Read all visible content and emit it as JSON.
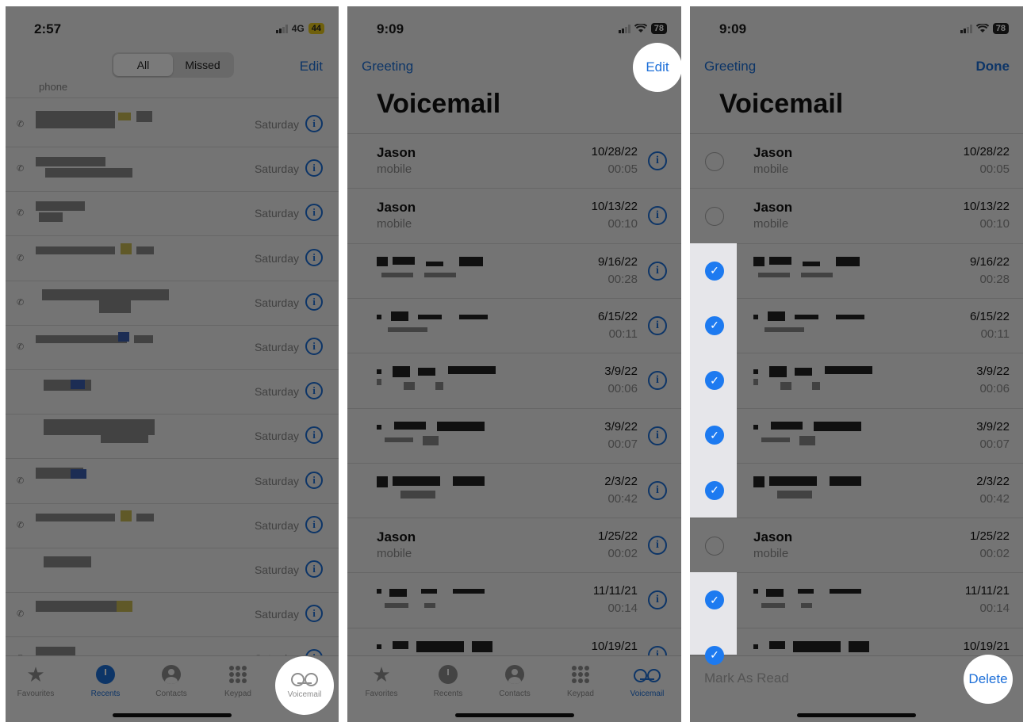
{
  "panel1": {
    "status": {
      "time": "2:57",
      "network": "4G",
      "battery": "44"
    },
    "segments": [
      "All",
      "Missed"
    ],
    "edit_label": "Edit",
    "first_row_label": "phone",
    "first_row_date": "Saturday",
    "rows": [
      "Saturday",
      "Saturday",
      "Saturday",
      "Saturday",
      "Saturday",
      "Saturday",
      "Saturday",
      "Saturday",
      "Saturday",
      "Saturday",
      "Saturday",
      "Saturday",
      "Saturday"
    ],
    "tabs": [
      "Favourites",
      "Recents",
      "Contacts",
      "Keypad",
      "Voicemail"
    ],
    "highlighted_tab": "Voicemail"
  },
  "panel2": {
    "status": {
      "time": "9:09",
      "battery": "78"
    },
    "greeting_label": "Greeting",
    "edit_label": "Edit",
    "title": "Voicemail",
    "items": [
      {
        "name": "Jason",
        "sub": "mobile",
        "date": "10/28/22",
        "dur": "00:05"
      },
      {
        "name": "Jason",
        "sub": "mobile",
        "date": "10/13/22",
        "dur": "00:10"
      },
      {
        "name": "",
        "sub": "",
        "date": "9/16/22",
        "dur": "00:28"
      },
      {
        "name": "",
        "sub": "",
        "date": "6/15/22",
        "dur": "00:11"
      },
      {
        "name": "",
        "sub": "",
        "date": "3/9/22",
        "dur": "00:06"
      },
      {
        "name": "",
        "sub": "",
        "date": "3/9/22",
        "dur": "00:07"
      },
      {
        "name": "",
        "sub": "",
        "date": "2/3/22",
        "dur": "00:42"
      },
      {
        "name": "Jason",
        "sub": "mobile",
        "date": "1/25/22",
        "dur": "00:02"
      },
      {
        "name": "",
        "sub": "",
        "date": "11/11/21",
        "dur": "00:14"
      },
      {
        "name": "",
        "sub": "",
        "date": "10/19/21",
        "dur": ""
      }
    ],
    "tabs": [
      "Favorites",
      "Recents",
      "Contacts",
      "Keypad",
      "Voicemail"
    ]
  },
  "panel3": {
    "status": {
      "time": "9:09",
      "battery": "78"
    },
    "greeting_label": "Greeting",
    "done_label": "Done",
    "title": "Voicemail",
    "items": [
      {
        "name": "Jason",
        "sub": "mobile",
        "date": "10/28/22",
        "dur": "00:05",
        "checked": false
      },
      {
        "name": "Jason",
        "sub": "mobile",
        "date": "10/13/22",
        "dur": "00:10",
        "checked": false
      },
      {
        "name": "",
        "sub": "",
        "date": "9/16/22",
        "dur": "00:28",
        "checked": true
      },
      {
        "name": "",
        "sub": "",
        "date": "6/15/22",
        "dur": "00:11",
        "checked": true
      },
      {
        "name": "",
        "sub": "",
        "date": "3/9/22",
        "dur": "00:06",
        "checked": true
      },
      {
        "name": "",
        "sub": "",
        "date": "3/9/22",
        "dur": "00:07",
        "checked": true
      },
      {
        "name": "",
        "sub": "",
        "date": "2/3/22",
        "dur": "00:42",
        "checked": true
      },
      {
        "name": "Jason",
        "sub": "mobile",
        "date": "1/25/22",
        "dur": "00:02",
        "checked": false
      },
      {
        "name": "",
        "sub": "",
        "date": "11/11/21",
        "dur": "00:14",
        "checked": true
      },
      {
        "name": "",
        "sub": "",
        "date": "10/19/21",
        "dur": "",
        "checked": true
      }
    ],
    "mark_as_read_label": "Mark As Read",
    "delete_label": "Delete"
  },
  "colors": {
    "accent": "#1d6fd8",
    "check": "#1d7af0",
    "dim_overlay": "rgba(0,0,0,0.52)",
    "battery_low": "#e9c81a"
  },
  "icons": [
    "info-icon",
    "star-icon",
    "clock-icon",
    "person-icon",
    "keypad-icon",
    "voicemail-icon",
    "checkmark-icon",
    "phone-icon",
    "signal-icon",
    "wifi-icon",
    "battery-icon"
  ]
}
